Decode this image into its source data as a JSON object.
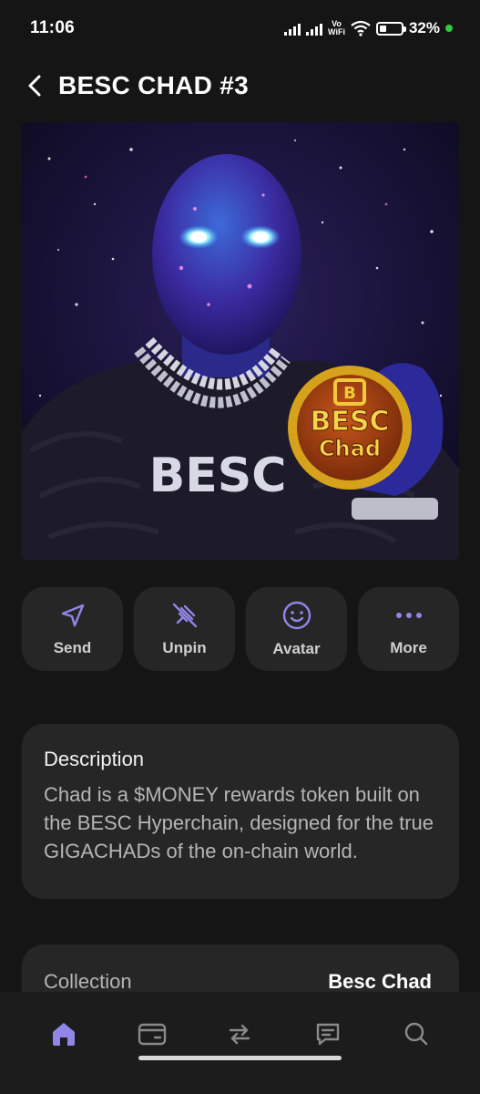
{
  "status_bar": {
    "time": "11:06",
    "network_label_top": "Vo",
    "network_label_bottom": "WiFi",
    "battery_percent": "32%"
  },
  "header": {
    "title": "BESC CHAD #3"
  },
  "nft": {
    "shirt_text": "BESC",
    "coin_text_top": "BESC",
    "coin_text_bottom": "Chad",
    "coin_emblem": "B"
  },
  "actions": [
    {
      "label": "Send",
      "icon": "send-icon"
    },
    {
      "label": "Unpin",
      "icon": "unpin-icon"
    },
    {
      "label": "Avatar",
      "icon": "smiley-icon"
    },
    {
      "label": "More",
      "icon": "more-dots-icon"
    }
  ],
  "description": {
    "title": "Description",
    "text": "Chad is a $MONEY rewards token built on the BESC Hyperchain, designed for the true GIGACHADs of the on-chain world."
  },
  "collection": {
    "label": "Collection",
    "value": "Besc Chad"
  },
  "bottom_nav": [
    {
      "name": "home",
      "icon": "home-icon",
      "active": true
    },
    {
      "name": "wallet",
      "icon": "wallet-icon",
      "active": false
    },
    {
      "name": "swap",
      "icon": "swap-icon",
      "active": false
    },
    {
      "name": "messages",
      "icon": "chat-icon",
      "active": false
    },
    {
      "name": "search",
      "icon": "search-icon",
      "active": false
    }
  ],
  "colors": {
    "background": "#151515",
    "card": "#262626",
    "accent": "#8f86e8",
    "icon_inactive": "#8a8a8a"
  }
}
